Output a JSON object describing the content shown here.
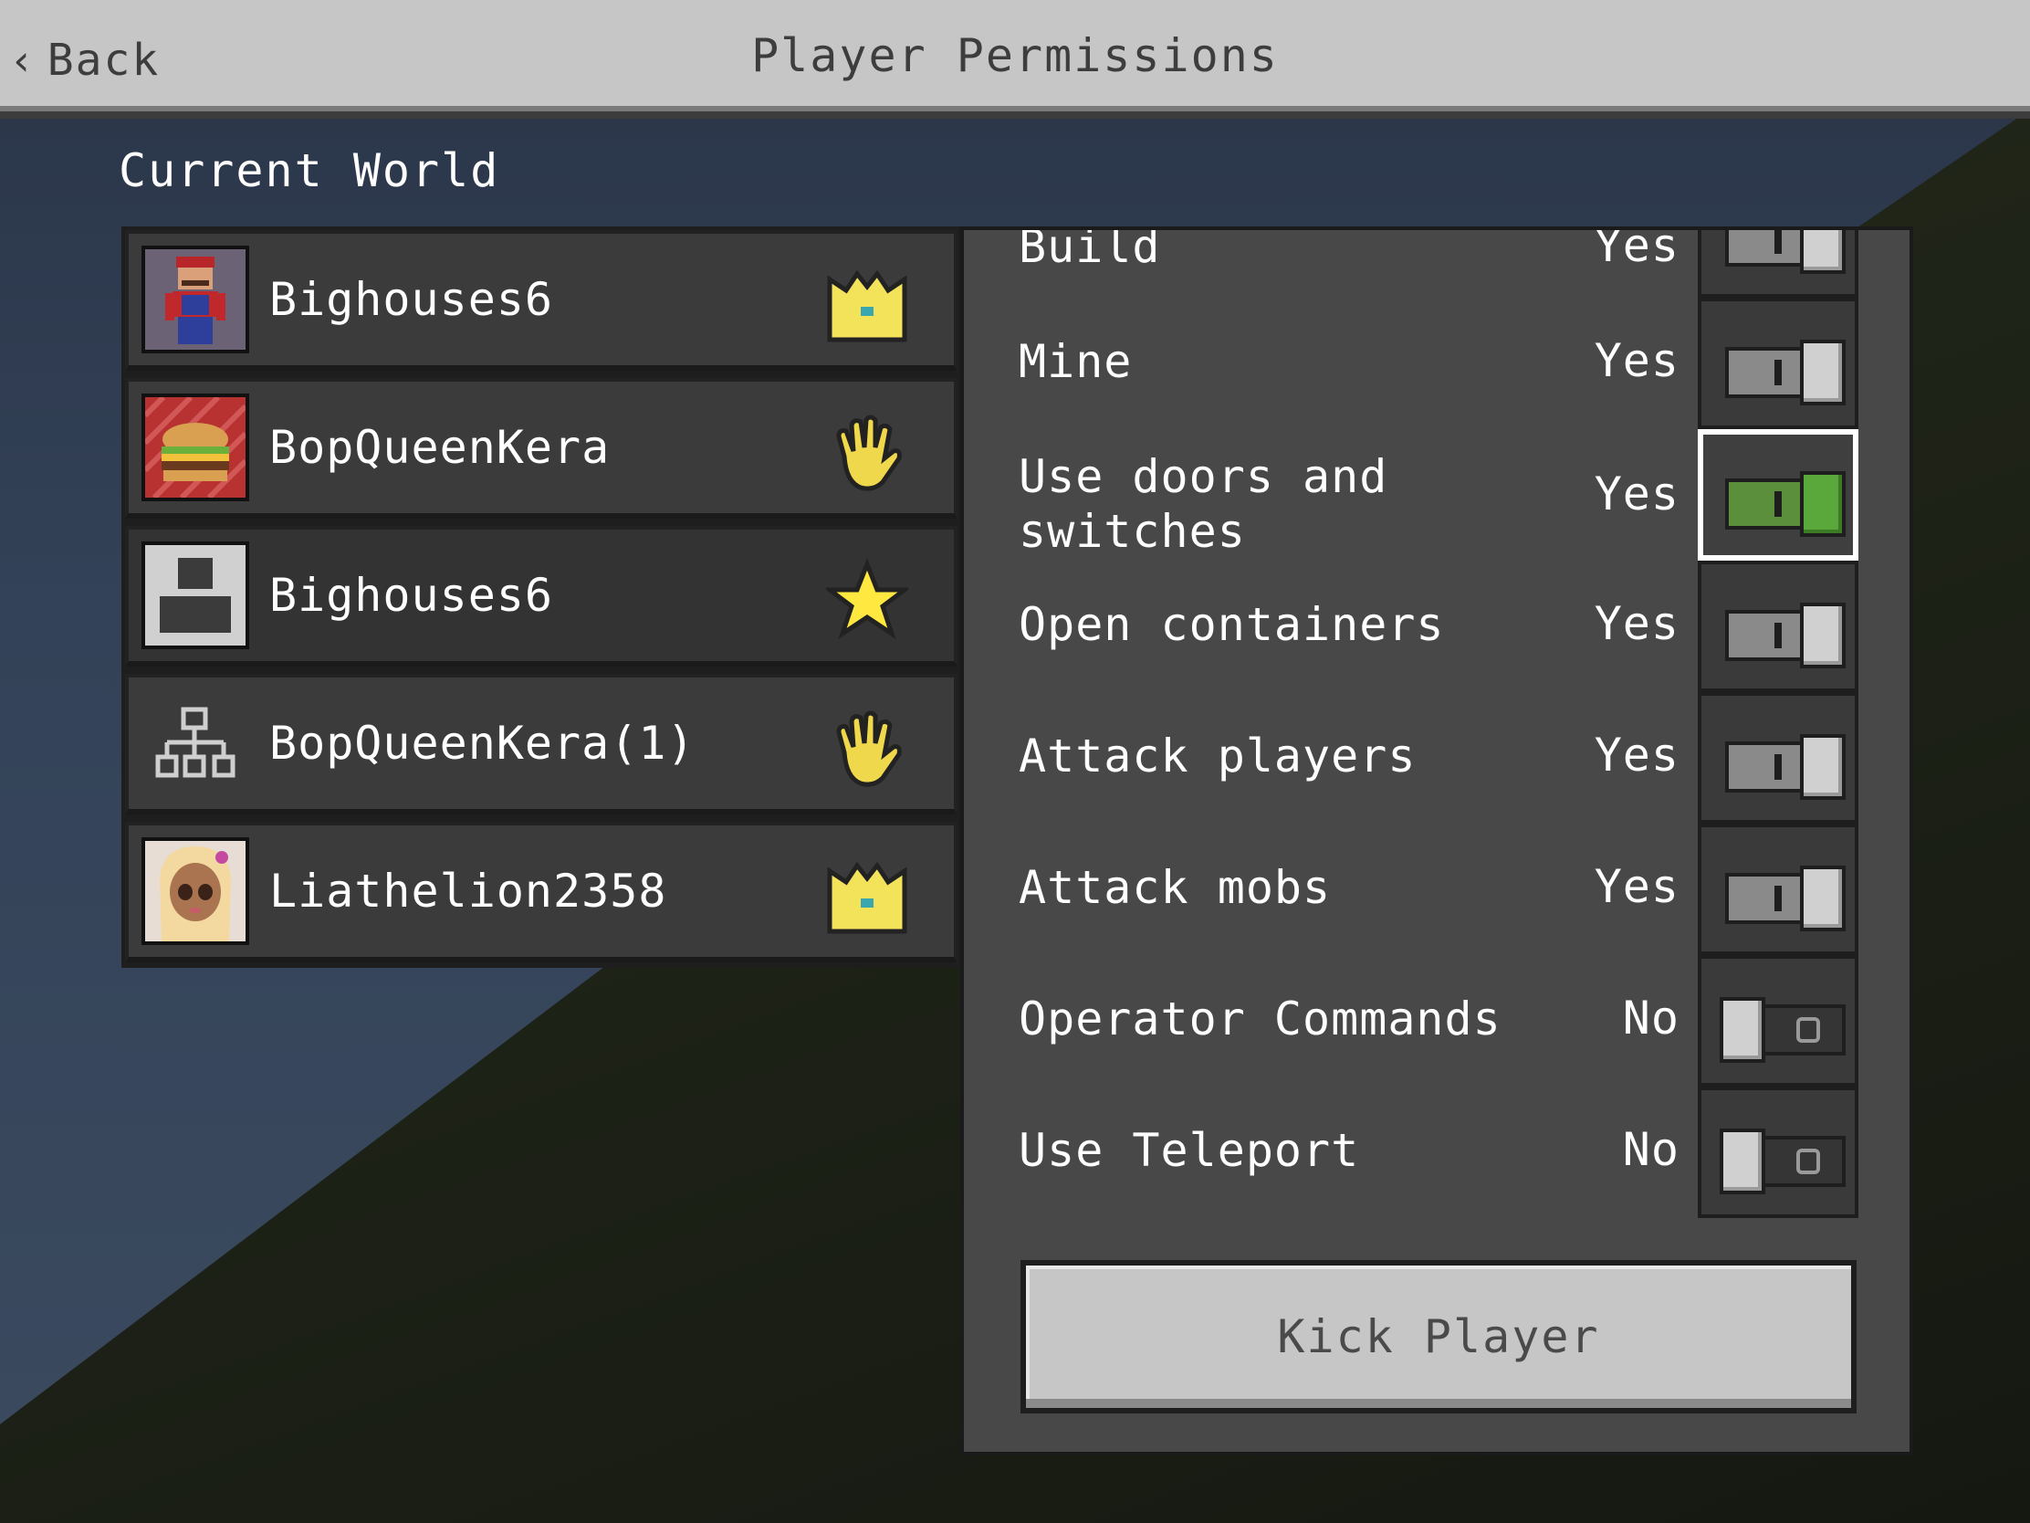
{
  "header": {
    "back_label": "Back",
    "title": "Player Permissions"
  },
  "section_title": "Current World",
  "players": [
    {
      "name": "Bighouses6",
      "role_icon": "crown-icon",
      "avatar": "skin-avatar"
    },
    {
      "name": "BopQueenKera",
      "role_icon": "waving-hand-icon",
      "avatar": "burger-avatar"
    },
    {
      "name": "Bighouses6",
      "role_icon": "star-icon",
      "avatar": "default-avatar"
    },
    {
      "name": "BopQueenKera(1)",
      "role_icon": "waving-hand-icon",
      "avatar": "network-avatar"
    },
    {
      "name": "Liathelion2358",
      "role_icon": "crown-icon",
      "avatar": "doll-avatar"
    }
  ],
  "permissions": [
    {
      "label": "Build",
      "value": "Yes",
      "on": true
    },
    {
      "label": "Mine",
      "value": "Yes",
      "on": true
    },
    {
      "label": "Use doors and switches",
      "value": "Yes",
      "on": true,
      "focused": true
    },
    {
      "label": "Open containers",
      "value": "Yes",
      "on": true
    },
    {
      "label": "Attack players",
      "value": "Yes",
      "on": true
    },
    {
      "label": "Attack mobs",
      "value": "Yes",
      "on": true
    },
    {
      "label": "Operator Commands",
      "value": "No",
      "on": false
    },
    {
      "label": "Use Teleport",
      "value": "No",
      "on": false
    }
  ],
  "kick_label": "Kick Player",
  "colors": {
    "header_bg": "#c6c6c6",
    "panel_bg": "#484848",
    "toggle_on_focused": "#5aa83c",
    "crown": "#f2e35a",
    "hand": "#f0d84c",
    "star": "#ffe840"
  }
}
